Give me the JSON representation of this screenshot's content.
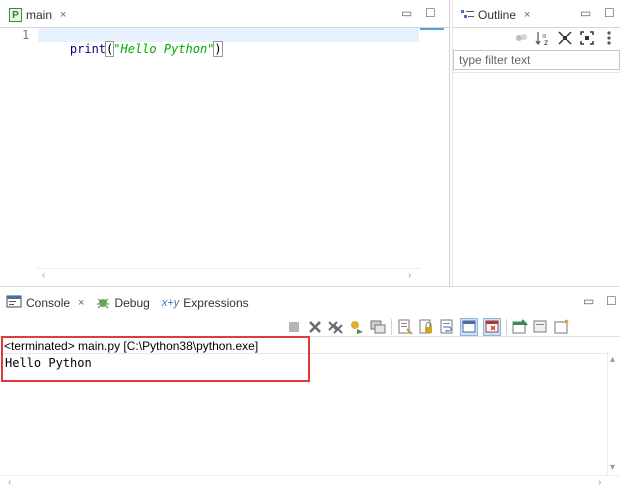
{
  "editor": {
    "tab_icon_letter": "P",
    "tab_label": "main",
    "close_glyph": "×",
    "minimize_glyph": "▭",
    "maximize_glyph": "☐",
    "line_number": "1",
    "code_keyword": "print",
    "code_open": "(",
    "code_string": "\"Hello Python\"",
    "code_close": ")",
    "scroll_left": "‹",
    "scroll_right": "›"
  },
  "outline": {
    "tab_label": "Outline",
    "close_glyph": "×",
    "minimize_glyph": "▭",
    "maximize_glyph": "☐",
    "filter_placeholder": "type filter text",
    "toolbar_icons": [
      "focus-icon",
      "sort-az-icon",
      "collapse-icon",
      "expand-icon",
      "view-menu-icon"
    ]
  },
  "console": {
    "tabs": [
      {
        "label": "Console",
        "icon": "console-icon",
        "active": true
      },
      {
        "label": "Debug",
        "icon": "debug-icon",
        "active": false
      },
      {
        "label": "Expressions",
        "icon": "expressions-icon",
        "active": false
      }
    ],
    "close_glyph": "×",
    "minimize_glyph": "▭",
    "maximize_glyph": "☐",
    "terminated_line": "<terminated> main.py [C:\\Python38\\python.exe]",
    "output": "Hello Python",
    "highlight_color": "#e03a3a"
  }
}
